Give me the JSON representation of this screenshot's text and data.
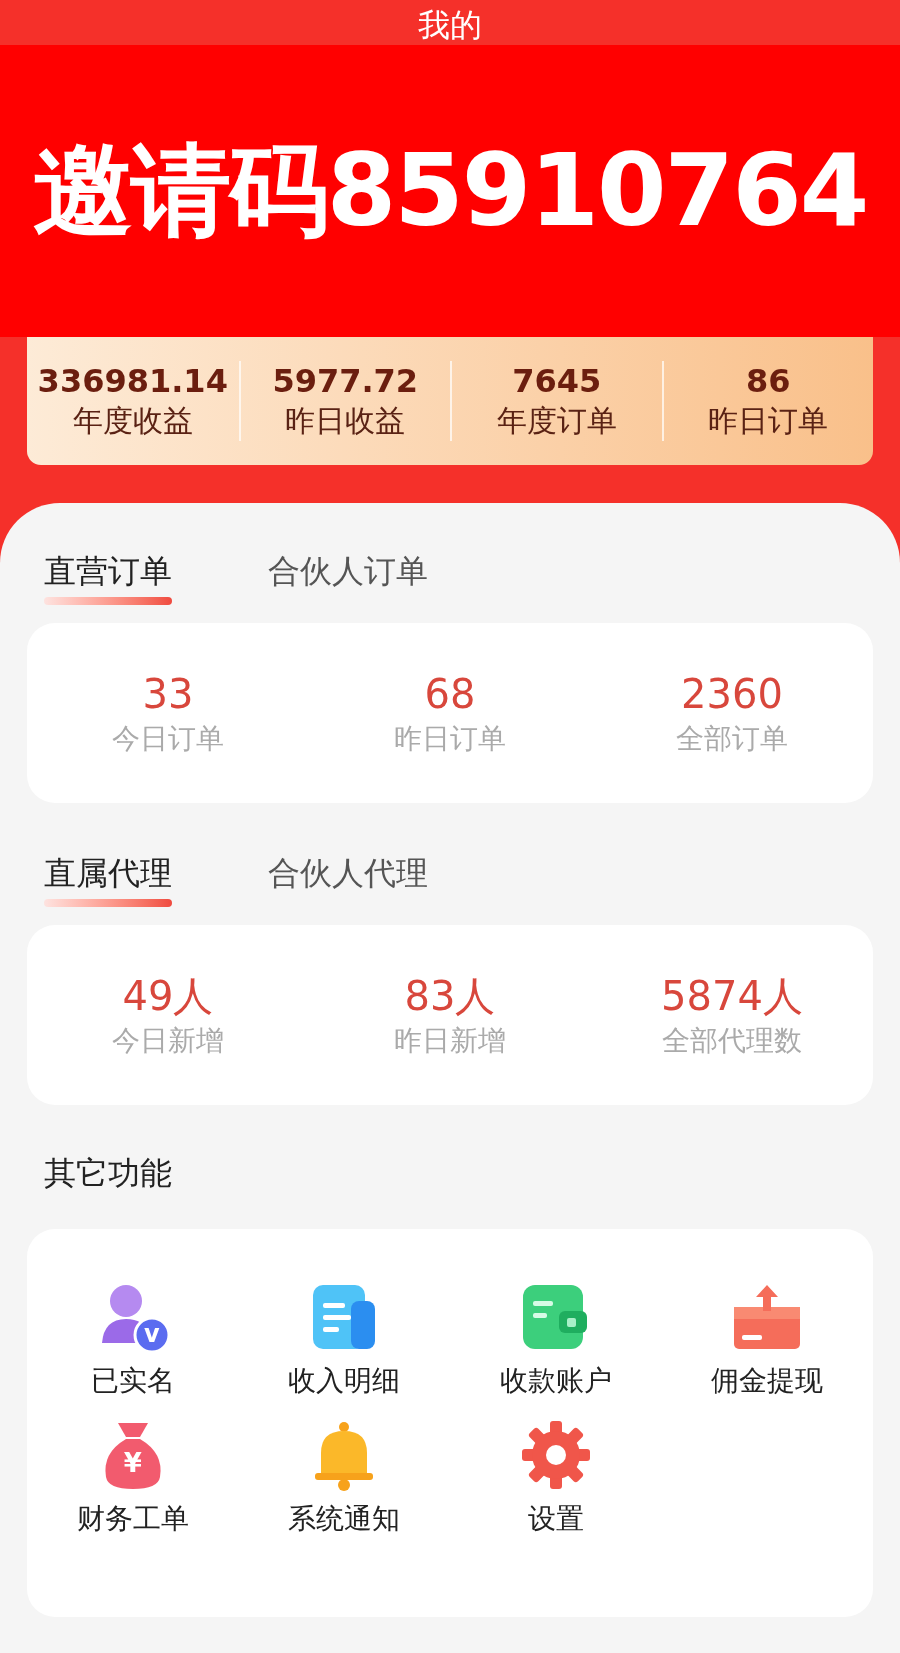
{
  "header": {
    "title": "我的"
  },
  "banner": {
    "text": "邀请码85910764"
  },
  "summary": [
    {
      "value": "336981.14",
      "label": "年度收益"
    },
    {
      "value": "5977.72",
      "label": "昨日收益"
    },
    {
      "value": "7645",
      "label": "年度订单"
    },
    {
      "value": "86",
      "label": "昨日订单"
    }
  ],
  "order_tabs": [
    {
      "label": "直营订单",
      "selected": true
    },
    {
      "label": "合伙人订单",
      "selected": false
    }
  ],
  "order_stats": [
    {
      "value": "33",
      "label": "今日订单"
    },
    {
      "value": "68",
      "label": "昨日订单"
    },
    {
      "value": "2360",
      "label": "全部订单"
    }
  ],
  "agent_tabs": [
    {
      "label": "直属代理",
      "selected": true
    },
    {
      "label": "合伙人代理",
      "selected": false
    }
  ],
  "agent_stats": [
    {
      "value": "49人",
      "label": "今日新增"
    },
    {
      "value": "83人",
      "label": "昨日新增"
    },
    {
      "value": "5874人",
      "label": "全部代理数"
    }
  ],
  "other": {
    "title": "其它功能",
    "items": [
      {
        "label": "已实名",
        "kind": "verified",
        "glyph": "v"
      },
      {
        "label": "收入明细",
        "kind": "document"
      },
      {
        "label": "收款账户",
        "kind": "wallet"
      },
      {
        "label": "佣金提现",
        "kind": "withdraw"
      },
      {
        "label": "财务工单",
        "kind": "bag",
        "glyph": "¥"
      },
      {
        "label": "系统通知",
        "kind": "bell"
      },
      {
        "label": "设置",
        "kind": "gear"
      }
    ]
  }
}
